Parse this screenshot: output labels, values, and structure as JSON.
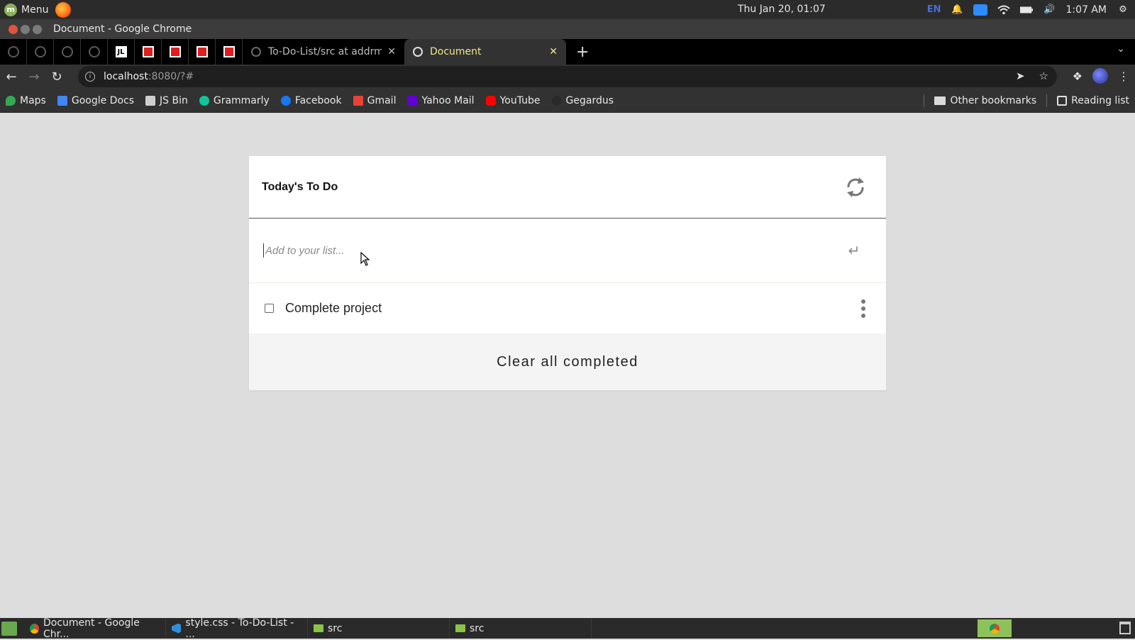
{
  "system_panel": {
    "menu_label": "Menu",
    "clock_center": "Thu Jan 20, 01:07",
    "lang": "EN",
    "clock_right": "1:07 AM"
  },
  "window": {
    "title": "Document - Google Chrome"
  },
  "tabs": [
    {
      "label": "To-Do-List/src at addrmv",
      "active": false
    },
    {
      "label": "Document",
      "active": true
    }
  ],
  "address_bar": {
    "host": "localhost",
    "rest": ":8080/?#"
  },
  "bookmarks": [
    {
      "label": "Maps",
      "color": "#34a853"
    },
    {
      "label": "Google Docs",
      "color": "#4285f4"
    },
    {
      "label": "JS Bin",
      "color": "#e0e0e0"
    },
    {
      "label": "Grammarly",
      "color": "#15c39a"
    },
    {
      "label": "Facebook",
      "color": "#1877f2"
    },
    {
      "label": "Gmail",
      "color": "#ea4335"
    },
    {
      "label": "Yahoo Mail",
      "color": "#6001d2"
    },
    {
      "label": "YouTube",
      "color": "#ff0000"
    },
    {
      "label": "Gegardus",
      "color": "#323232"
    }
  ],
  "bookmarks_right": {
    "other": "Other bookmarks",
    "reading": "Reading list"
  },
  "todo": {
    "title": "Today's To Do",
    "input_placeholder": "Add to your list...",
    "items": [
      {
        "label": "Complete project",
        "completed": false
      }
    ],
    "clear_label": "Clear all completed"
  },
  "taskbar": {
    "items": [
      {
        "label": "Document - Google Chr...",
        "icon": "chrome-icon"
      },
      {
        "label": "style.css - To-Do-List - ...",
        "icon": "vscode-icon"
      },
      {
        "label": "src",
        "icon": "folder-icon"
      },
      {
        "label": "src",
        "icon": "folder-icon"
      }
    ]
  }
}
